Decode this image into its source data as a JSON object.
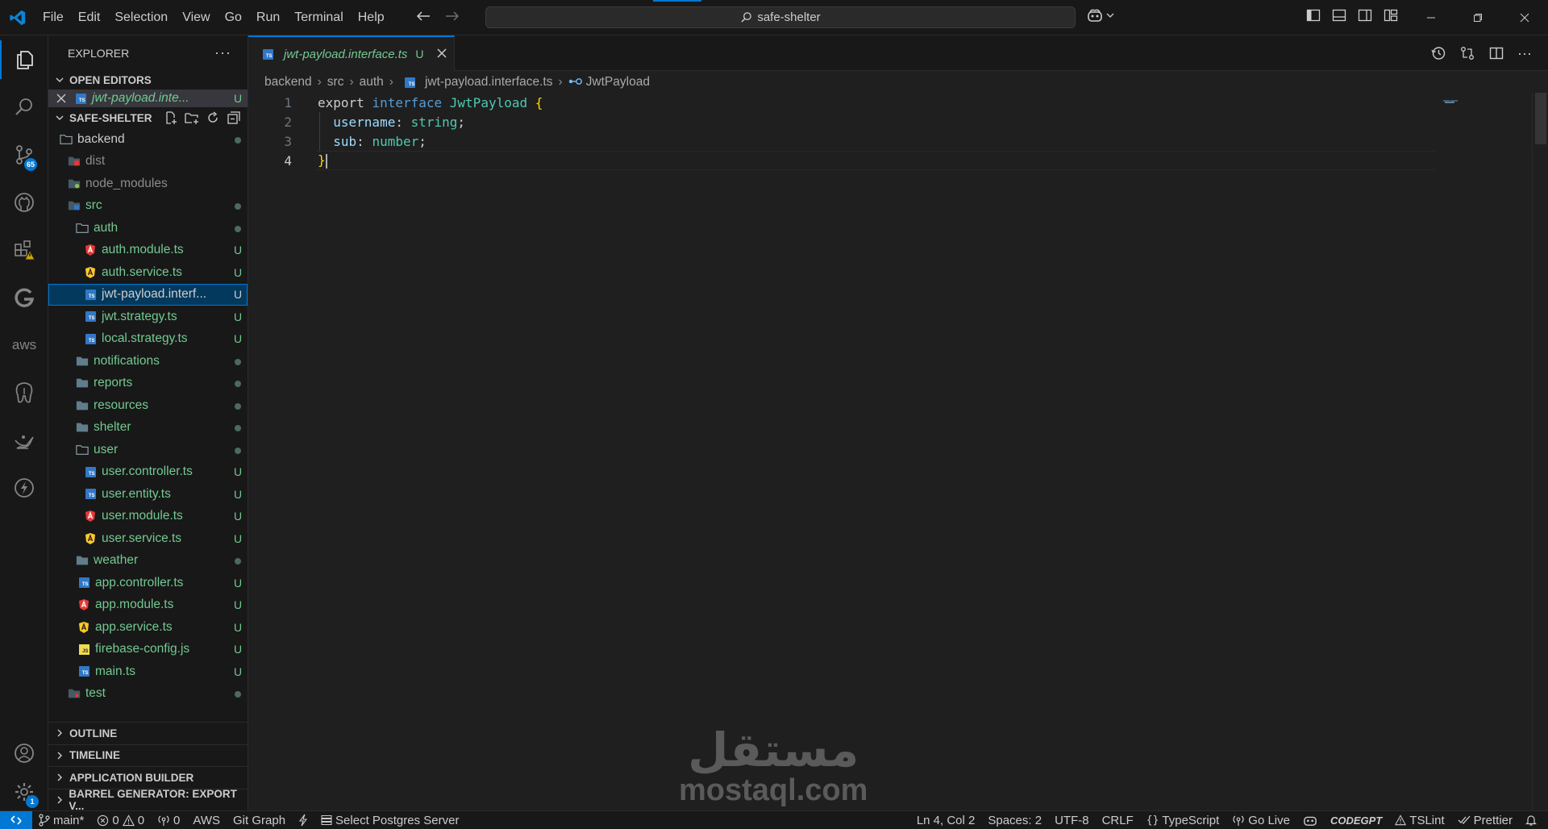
{
  "menu": [
    "File",
    "Edit",
    "Selection",
    "View",
    "Go",
    "Run",
    "Terminal",
    "Help"
  ],
  "search": {
    "text": "safe-shelter"
  },
  "activity": {
    "scm_badge": "65",
    "settings_badge": "1",
    "aws_label": "aws"
  },
  "explorer": {
    "title": "EXPLORER",
    "open_editors_title": "OPEN EDITORS",
    "open_editor": {
      "name": "jwt-payload.inte...",
      "status": "U"
    },
    "project_title": "SAFE-SHELTER",
    "tree": [
      {
        "name": "backend",
        "status": "",
        "color": "white"
      },
      {
        "name": "dist",
        "status": "",
        "color": "grey"
      },
      {
        "name": "node_modules",
        "status": "",
        "color": "grey"
      },
      {
        "name": "src",
        "status": "",
        "color": "green"
      },
      {
        "name": "auth",
        "status": "",
        "color": "green"
      },
      {
        "name": "auth.module.ts",
        "status": "U",
        "color": "green"
      },
      {
        "name": "auth.service.ts",
        "status": "U",
        "color": "green"
      },
      {
        "name": "jwt-payload.interf...",
        "status": "U",
        "color": "white"
      },
      {
        "name": "jwt.strategy.ts",
        "status": "U",
        "color": "green"
      },
      {
        "name": "local.strategy.ts",
        "status": "U",
        "color": "green"
      },
      {
        "name": "notifications",
        "status": "",
        "color": "green"
      },
      {
        "name": "reports",
        "status": "",
        "color": "green"
      },
      {
        "name": "resources",
        "status": "",
        "color": "green"
      },
      {
        "name": "shelter",
        "status": "",
        "color": "green"
      },
      {
        "name": "user",
        "status": "",
        "color": "green"
      },
      {
        "name": "user.controller.ts",
        "status": "U",
        "color": "green"
      },
      {
        "name": "user.entity.ts",
        "status": "U",
        "color": "green"
      },
      {
        "name": "user.module.ts",
        "status": "U",
        "color": "green"
      },
      {
        "name": "user.service.ts",
        "status": "U",
        "color": "green"
      },
      {
        "name": "weather",
        "status": "",
        "color": "green"
      },
      {
        "name": "app.controller.ts",
        "status": "U",
        "color": "green"
      },
      {
        "name": "app.module.ts",
        "status": "U",
        "color": "green"
      },
      {
        "name": "app.service.ts",
        "status": "U",
        "color": "green"
      },
      {
        "name": "firebase-config.js",
        "status": "U",
        "color": "green"
      },
      {
        "name": "main.ts",
        "status": "U",
        "color": "green"
      },
      {
        "name": "test",
        "status": "",
        "color": "green"
      }
    ],
    "sections": [
      "OUTLINE",
      "TIMELINE",
      "APPLICATION BUILDER",
      "BARREL GENERATOR: EXPORT V..."
    ]
  },
  "tab": {
    "label": "jwt-payload.interface.ts",
    "status": "U"
  },
  "breadcrumb": [
    "backend",
    "src",
    "auth",
    "jwt-payload.interface.ts",
    "JwtPayload"
  ],
  "code": {
    "line_numbers": [
      "1",
      "2",
      "3",
      "4"
    ],
    "l1": {
      "kw1": "export",
      "kw2": "interface",
      "name": "JwtPayload",
      "brace": "{"
    },
    "l2": {
      "prop": "username",
      "colon": ":",
      "type": "string",
      "semi": ";"
    },
    "l3": {
      "prop": "sub",
      "colon": ":",
      "type": "number",
      "semi": ";"
    },
    "l4": {
      "brace": "}"
    }
  },
  "watermark": {
    "arabic": "مستقل",
    "latin": "mostaql.com"
  },
  "status": {
    "branch": "main*",
    "errors": "0",
    "warnings": "0",
    "ports": "0",
    "aws": "AWS",
    "git_graph": "Git Graph",
    "postgres": "Select Postgres Server",
    "position": "Ln 4, Col 2",
    "spaces": "Spaces: 2",
    "encoding": "UTF-8",
    "eol": "CRLF",
    "language": "TypeScript",
    "golive": "Go Live",
    "codegpt": "CODEGPT",
    "tslint": "TSLint",
    "prettier": "Prettier"
  }
}
